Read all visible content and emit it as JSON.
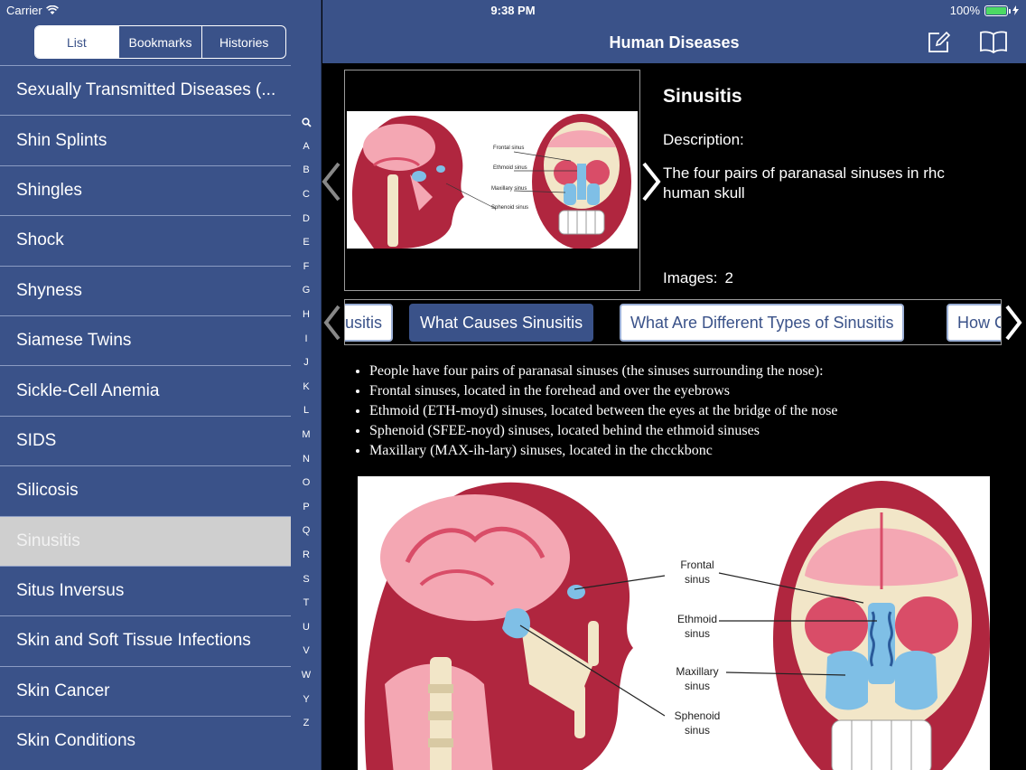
{
  "status": {
    "carrier": "Carrier",
    "time": "9:38 PM",
    "battery": "100%",
    "battery_level": 1.0
  },
  "segmented": {
    "list": "List",
    "bookmarks": "Bookmarks",
    "histories": "Histories"
  },
  "nav": {
    "title": "Human Diseases"
  },
  "list": [
    "Sexually Transmitted Diseases (...",
    "Shin Splints",
    "Shingles",
    "Shock",
    "Shyness",
    "Siamese Twins",
    "Sickle-Cell Anemia",
    "SIDS",
    "Silicosis",
    "Sinusitis",
    "Situs Inversus",
    "Skin and Soft Tissue Infections",
    "Skin Cancer",
    "Skin Conditions"
  ],
  "index": [
    "A",
    "B",
    "C",
    "D",
    "E",
    "F",
    "G",
    "H",
    "I",
    "J",
    "K",
    "L",
    "M",
    "N",
    "O",
    "P",
    "Q",
    "R",
    "S",
    "T",
    "U",
    "V",
    "W",
    "Y",
    "Z"
  ],
  "detail": {
    "title": "Sinusitis",
    "description_label": "Description:",
    "description": "The four pairs of paranasal sinuses in rhc human skull",
    "images_label": "Images:",
    "images_count": "2"
  },
  "hero_labels": {
    "frontal": "Frontal sinus",
    "ethmoid": "Ethmoid sinus",
    "maxillary": "Maxillary sinus",
    "sphenoid": "Sphenoid sinus"
  },
  "tabs": [
    "usitis",
    "What Causes Sinusitis",
    "What Are Different Types of Sinusitis",
    "How C"
  ],
  "bullets": [
    "People have four pairs of paranasal sinuses (the sinuses surrounding the nose):",
    "Frontal sinuses, located in the forehead and over the eyebrows",
    "Ethmoid (ETH-moyd) sinuses, located between the eyes at the bridge of the nose",
    "Sphenoid (SFEE-noyd) sinuses, located behind the ethmoid sinuses",
    "Maxillary (MAX-ih-lary) sinuses, located in the chcckbonc"
  ],
  "figure_labels": {
    "frontal_1": "Frontal",
    "frontal_2": "sinus",
    "ethmoid_1": "Ethmoid",
    "ethmoid_2": "sinus",
    "maxillary_1": "Maxillary",
    "maxillary_2": "sinus",
    "sphenoid_1": "Sphenoid",
    "sphenoid_2": "sinus"
  }
}
